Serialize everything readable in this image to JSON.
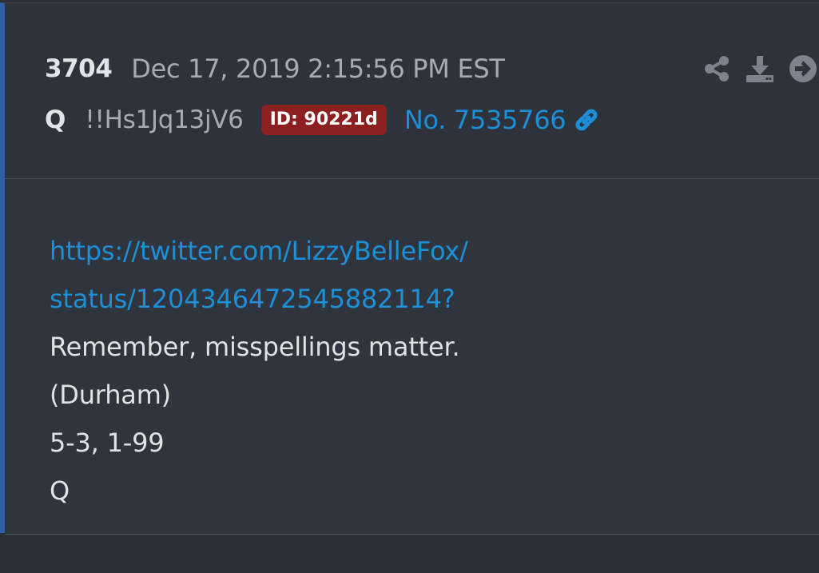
{
  "post": {
    "number": "3704",
    "timestamp": "Dec 17, 2019 2:15:56 PM EST",
    "author": "Q",
    "tripcode": "!!Hs1Jq13jV6",
    "id_badge": "ID: 90221d",
    "post_no": "No. 7535766",
    "link_line_1": "https://twitter.com/LizzyBelleFox/",
    "link_line_2": "status/1204346472545882114?",
    "text_lines": [
      "Remember, misspellings matter.",
      "(Durham)",
      "5-3, 1-99",
      "Q"
    ]
  },
  "icons": {
    "share": "share-icon",
    "download": "download-icon",
    "goto": "arrow-circle-right-icon",
    "permalink": "link-icon"
  },
  "colors": {
    "accent_link": "#1d8fd6",
    "id_badge_bg": "#8c2020",
    "left_bar": "#2f5fa6"
  }
}
